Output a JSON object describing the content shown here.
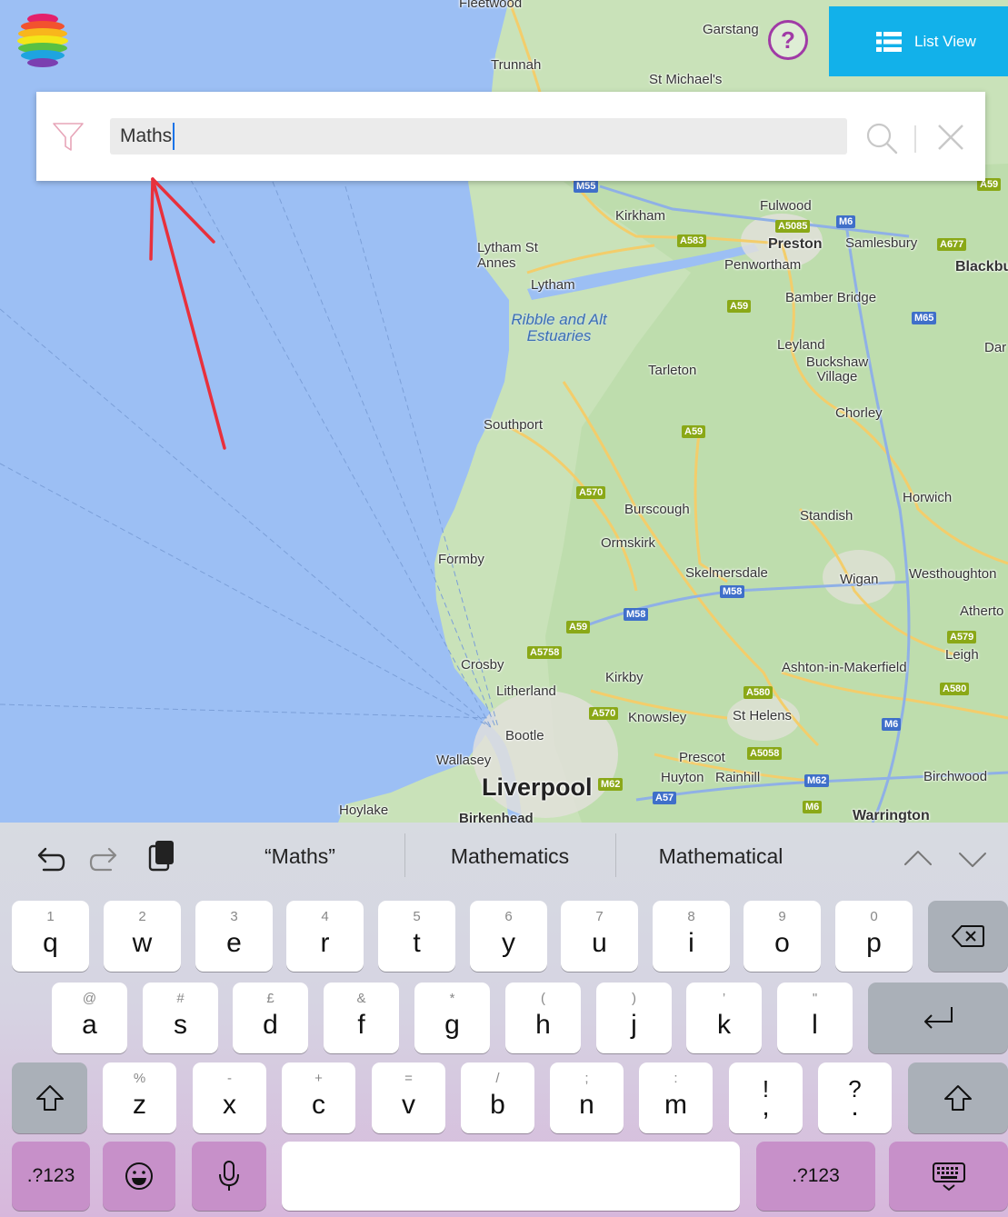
{
  "app": {
    "help_label": "?",
    "list_view_label": "List View"
  },
  "search": {
    "value": "Maths"
  },
  "map": {
    "places": [
      "Fleetwood",
      "Garstang",
      "Trunnah",
      "St Michael's",
      "Kirkham",
      "Fulwood",
      "Preston",
      "Samlesbury",
      "Lytham St Annes",
      "Penwortham",
      "Blackbu",
      "Lytham",
      "Bamber Bridge",
      "Ribble and Alt Estuaries",
      "Leyland",
      "Dar",
      "Buckshaw Village",
      "Tarleton",
      "Chorley",
      "Southport",
      "Horwich",
      "Burscough",
      "Standish",
      "Ormskirk",
      "Formby",
      "Skelmersdale",
      "Wigan",
      "Westhoughton",
      "Atherto",
      "Leigh",
      "Crosby",
      "Litherland",
      "Kirkby",
      "Ashton-in-Makerfield",
      "Knowsley",
      "St Helens",
      "Bootle",
      "Wallasey",
      "Prescot",
      "Huyton",
      "Rainhill",
      "Birchwood",
      "Liverpool",
      "Hoylake",
      "Birkenhead",
      "Warrington"
    ],
    "roads": [
      "M55",
      "A59",
      "M6",
      "A5085",
      "A583",
      "A677",
      "M65",
      "A59",
      "A59",
      "A570",
      "M58",
      "M58",
      "A59",
      "A5758",
      "A579",
      "A580",
      "A580",
      "M6",
      "A570",
      "A5058",
      "M62",
      "M62",
      "A57",
      "M6"
    ]
  },
  "keyboard": {
    "suggestions": [
      "“Maths”",
      "Mathematics",
      "Mathematical"
    ],
    "row1": [
      {
        "k": "q",
        "h": "1"
      },
      {
        "k": "w",
        "h": "2"
      },
      {
        "k": "e",
        "h": "3"
      },
      {
        "k": "r",
        "h": "4"
      },
      {
        "k": "t",
        "h": "5"
      },
      {
        "k": "y",
        "h": "6"
      },
      {
        "k": "u",
        "h": "7"
      },
      {
        "k": "i",
        "h": "8"
      },
      {
        "k": "o",
        "h": "9"
      },
      {
        "k": "p",
        "h": "0"
      }
    ],
    "row2": [
      {
        "k": "a",
        "h": "@"
      },
      {
        "k": "s",
        "h": "#"
      },
      {
        "k": "d",
        "h": "£"
      },
      {
        "k": "f",
        "h": "&"
      },
      {
        "k": "g",
        "h": "*"
      },
      {
        "k": "h",
        "h": "("
      },
      {
        "k": "j",
        "h": ")"
      },
      {
        "k": "k",
        "h": "’"
      },
      {
        "k": "l",
        "h": "\""
      }
    ],
    "row3": [
      {
        "k": "z",
        "h": "%"
      },
      {
        "k": "x",
        "h": "-"
      },
      {
        "k": "c",
        "h": "+"
      },
      {
        "k": "v",
        "h": "="
      },
      {
        "k": "b",
        "h": "/"
      },
      {
        "k": "n",
        "h": ";"
      },
      {
        "k": "m",
        "h": ":"
      },
      {
        "k": ",",
        "h": "!"
      },
      {
        "k": ".",
        "h": "?"
      }
    ],
    "numbers_label": ".?123",
    "colors": {
      "accent_purple": "#c790c9",
      "list_view_blue": "#12b1ea",
      "help_purple": "#a03aa6",
      "arrow_red": "#e8303c"
    }
  }
}
